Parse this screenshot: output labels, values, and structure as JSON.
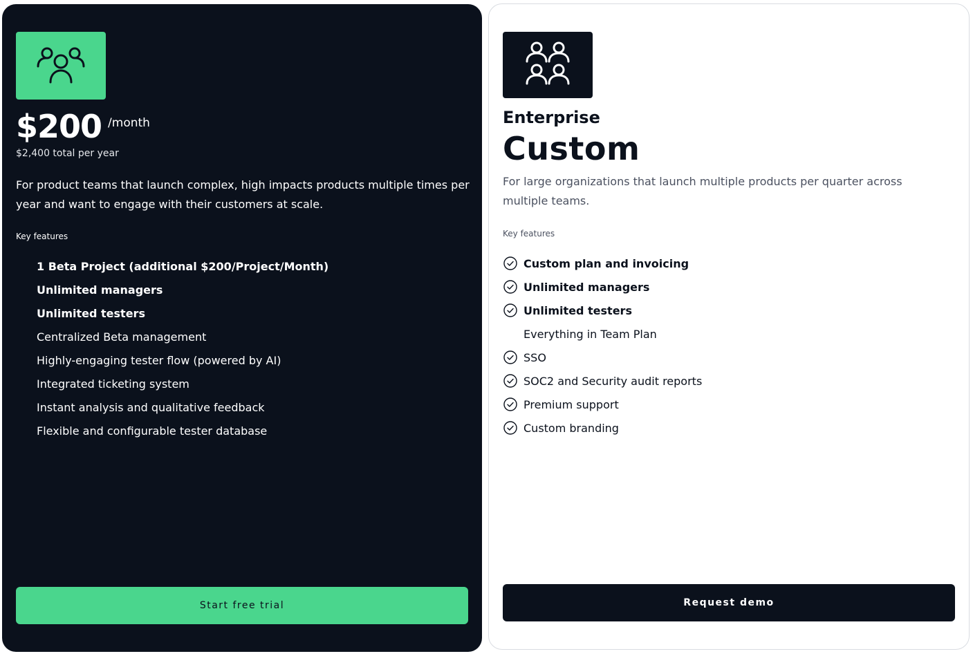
{
  "team_plan": {
    "icon": "users-group-icon",
    "accent_color": "#4ad68d",
    "background_color": "#0b111c",
    "price": "$200",
    "period": "/month",
    "total": "$2,400 total per year",
    "description": "For product teams that launch complex, high impacts products multiple times per year and want to engage with their customers at scale.",
    "key_features_label": "Key features",
    "features": [
      {
        "label": "1 Beta Project (additional $200/Project/Month)",
        "bold": true
      },
      {
        "label": "Unlimited managers",
        "bold": true
      },
      {
        "label": "Unlimited testers",
        "bold": true
      },
      {
        "label": "Centralized Beta management",
        "bold": false
      },
      {
        "label": "Highly-engaging tester flow (powered by AI)",
        "bold": false
      },
      {
        "label": "Integrated ticketing system",
        "bold": false
      },
      {
        "label": "Instant analysis and qualitative feedback",
        "bold": false
      },
      {
        "label": "Flexible and configurable tester database",
        "bold": false
      }
    ],
    "cta_label": "Start free trial"
  },
  "enterprise_plan": {
    "icon": "users-grid-icon",
    "kicker": "Enterprise",
    "title": "Custom",
    "description": "For large organizations that launch multiple products per quarter across multiple teams.",
    "key_features_label": "Key features",
    "features": [
      {
        "label": "Custom plan and invoicing",
        "bold": true,
        "check": true
      },
      {
        "label": "Unlimited managers",
        "bold": true,
        "check": true
      },
      {
        "label": "Unlimited testers",
        "bold": true,
        "check": true
      },
      {
        "label": "Everything in Team Plan",
        "bold": false,
        "check": false
      },
      {
        "label": "SSO",
        "bold": false,
        "check": true
      },
      {
        "label": "SOC2 and Security audit reports",
        "bold": false,
        "check": true
      },
      {
        "label": "Premium support",
        "bold": false,
        "check": true
      },
      {
        "label": "Custom branding",
        "bold": false,
        "check": true
      }
    ],
    "cta_label": "Request demo"
  }
}
